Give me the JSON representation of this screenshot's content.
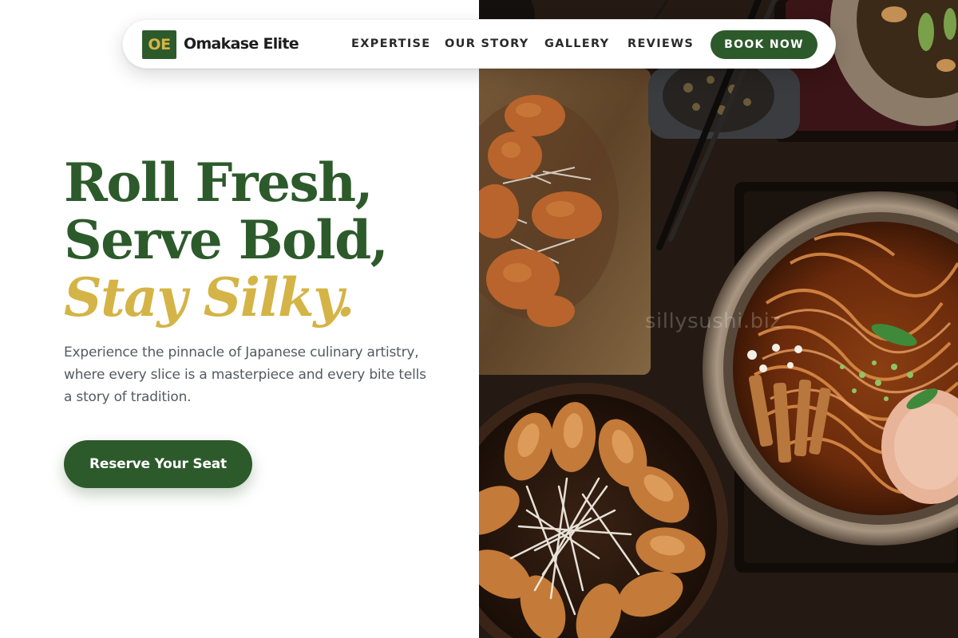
{
  "brand": {
    "badge": "OE",
    "name": "Omakase Elite"
  },
  "nav": {
    "links": [
      "EXPERTISE",
      "OUR STORY",
      "GALLERY",
      "REVIEWS"
    ],
    "cta": "BOOK NOW"
  },
  "hero": {
    "headline_line1": "Roll Fresh,",
    "headline_line2": "Serve Bold,",
    "headline_accent": "Stay Silky.",
    "description": "Experience the pinnacle of Japanese culinary artistry, where every slice is a masterpiece and every bite tells a story of tradition.",
    "cta": "Reserve Your Seat"
  },
  "image": {
    "watermark": "sillysushi.biz"
  },
  "colors": {
    "brand_green": "#2d5a2b",
    "accent_gold": "#d4b446",
    "body_text": "#555a60",
    "nav_text": "#2a2a2a"
  }
}
